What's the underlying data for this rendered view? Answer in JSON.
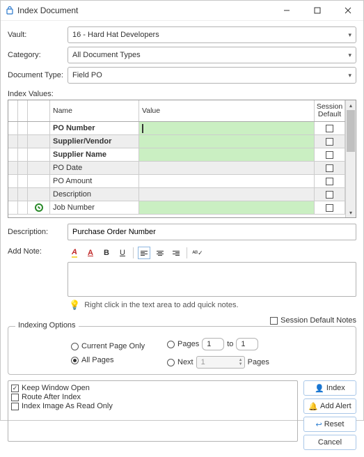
{
  "window": {
    "title": "Index Document"
  },
  "labels": {
    "vault": "Vault:",
    "category": "Category:",
    "document_type": "Document Type:",
    "index_values": "Index Values:",
    "description": "Description:",
    "add_note": "Add Note:",
    "indexing_options": "Indexing Options",
    "to": "to",
    "pages_suffix": "Pages"
  },
  "form": {
    "vault": "16 - Hard Hat Developers",
    "category": "All Document Types",
    "document_type": "Field PO"
  },
  "grid": {
    "headers": {
      "name": "Name",
      "value": "Value",
      "session_default": "Session\nDefault"
    },
    "rows": [
      {
        "name": "PO Number",
        "bold": true,
        "shaded": false,
        "value_green": true,
        "has_caret": true
      },
      {
        "name": "Supplier/Vendor",
        "bold": true,
        "shaded": true,
        "value_green": true
      },
      {
        "name": "Supplier Name",
        "bold": true,
        "shaded": false,
        "value_green": true
      },
      {
        "name": "PO Date",
        "bold": false,
        "shaded": true,
        "value_green": false
      },
      {
        "name": "PO Amount",
        "bold": false,
        "shaded": false,
        "value_green": false
      },
      {
        "name": "Description",
        "bold": false,
        "shaded": true,
        "value_green": false
      },
      {
        "name": "Job Number",
        "bold": false,
        "shaded": false,
        "value_green": true,
        "has_front_icon": true
      }
    ]
  },
  "description_value": "Purchase Order Number",
  "note_hint": "Right click in the text area to add quick notes.",
  "session_default_notes": "Session Default Notes",
  "indexing": {
    "current_page_only": "Current Page Only",
    "all_pages": "All Pages",
    "pages_label": "Pages",
    "next_label": "Next",
    "page_from": "1",
    "page_to": "1",
    "next_val": "1"
  },
  "checks": {
    "keep_open": "Keep Window Open",
    "route_after": "Route After Index",
    "read_only": "Index Image As Read Only"
  },
  "buttons": {
    "index": "Index",
    "add_alert": "Add Alert",
    "reset": "Reset",
    "cancel": "Cancel"
  },
  "toolbar_icons": {
    "font_color": "font-color-icon",
    "highlight": "highlight-icon",
    "bold": "B",
    "underline": "U",
    "align_left": "align-left-icon",
    "align_center": "align-center-icon",
    "align_right": "align-right-icon",
    "spellcheck": "spellcheck-icon"
  }
}
